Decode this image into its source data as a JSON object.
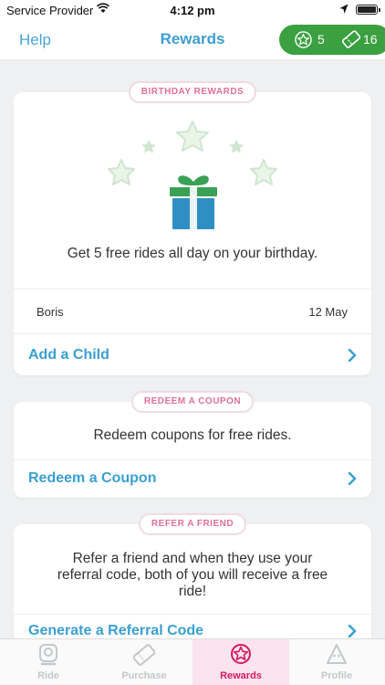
{
  "status_bar": {
    "carrier": "Service Provider",
    "time": "4:12 pm"
  },
  "nav": {
    "help": "Help",
    "title": "Rewards",
    "stars_count": "5",
    "tickets_count": "16"
  },
  "birthday_card": {
    "pill": "BIRTHDAY REWARDS",
    "description": "Get 5 free rides all day on your birthday.",
    "child_name": "Boris",
    "child_date": "12 May",
    "action": "Add a Child"
  },
  "coupon_card": {
    "pill": "REDEEM A COUPON",
    "description": "Redeem coupons for free rides.",
    "action": "Redeem a Coupon"
  },
  "refer_card": {
    "pill": "REFER A FRIEND",
    "description": "Refer a friend and when they use your referral code, both of you will receive a free ride!",
    "action": "Generate a Referral Code"
  },
  "tabs": [
    {
      "label": "Ride",
      "icon": "ride-icon"
    },
    {
      "label": "Purchase",
      "icon": "ticket-icon"
    },
    {
      "label": "Rewards",
      "icon": "star-icon"
    },
    {
      "label": "Profile",
      "icon": "profile-icon"
    }
  ],
  "colors": {
    "accent_blue": "#3d9ed6",
    "counts_green": "#3aa040",
    "pill_pink": "#e0709a",
    "active_tab": "#d61a63",
    "star_green": "#d6ecd6",
    "gift_top": "#3aa055",
    "gift_box": "#2f8fc4"
  }
}
